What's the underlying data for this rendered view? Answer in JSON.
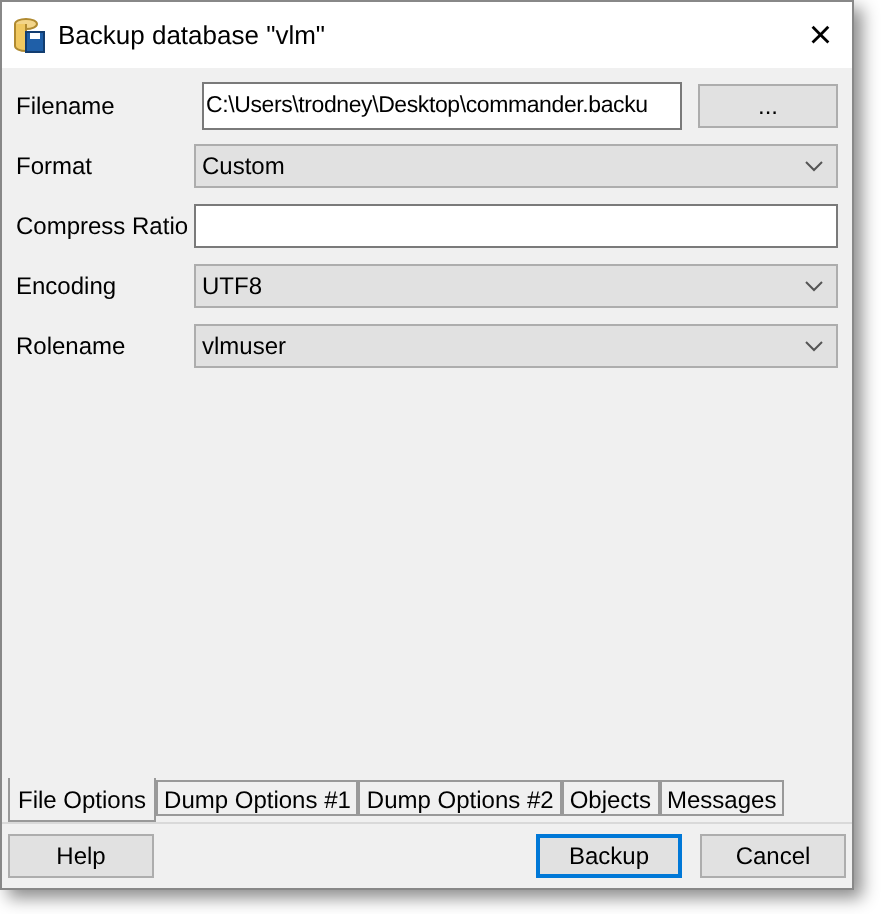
{
  "window": {
    "title": "Backup database \"vlm\"",
    "close": "×"
  },
  "fields": [
    {
      "kind": "file",
      "label": "Filename",
      "value": "C:\\Users\\trodney\\Desktop\\commander.backu",
      "button": "..."
    },
    {
      "kind": "select",
      "label": "Format",
      "value": "Custom"
    },
    {
      "kind": "text",
      "label": "Compress Ratio"
    },
    {
      "kind": "select",
      "label": "Encoding",
      "value": "UTF8"
    },
    {
      "kind": "select",
      "label": "Rolename",
      "value": "vlmuser"
    }
  ],
  "tabs": [
    {
      "label": "File Options",
      "selected": true
    },
    {
      "label": "Dump Options #1",
      "selected": false
    },
    {
      "label": "Dump Options #2",
      "selected": false
    },
    {
      "label": "Objects",
      "selected": false
    },
    {
      "label": "Messages",
      "selected": false
    }
  ],
  "buttons": [
    {
      "label": "Help",
      "focused": false
    },
    {
      "label": "Backup",
      "focused": true
    },
    {
      "label": "Cancel",
      "focused": false
    }
  ]
}
